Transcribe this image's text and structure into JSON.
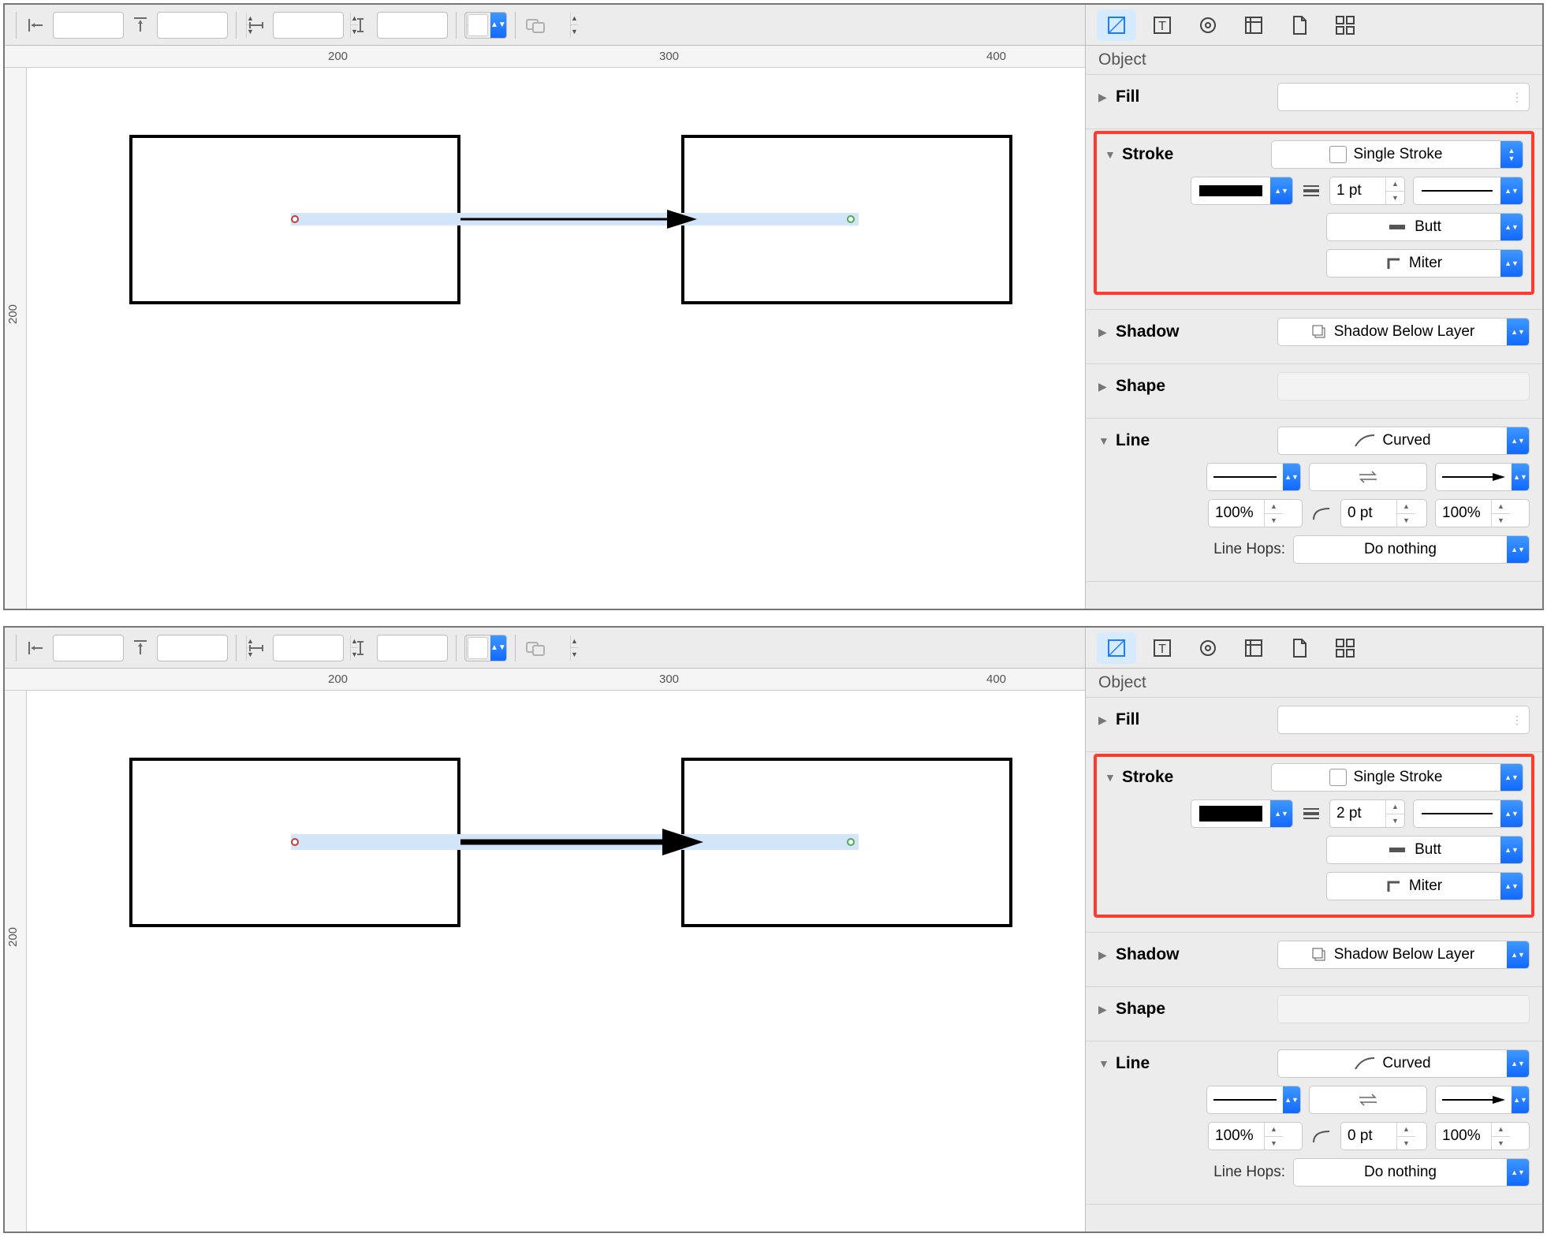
{
  "rulers": {
    "h1": "200",
    "h2": "300",
    "h3": "400",
    "v1": "200"
  },
  "inspector": {
    "title": "Object",
    "fill": {
      "label": "Fill"
    },
    "stroke": {
      "label": "Stroke",
      "type": "Single Stroke",
      "weight_top": "1 pt",
      "weight_bottom": "2 pt",
      "cap": "Butt",
      "join": "Miter"
    },
    "shadow": {
      "label": "Shadow",
      "mode": "Shadow Below Layer"
    },
    "shape": {
      "label": "Shape"
    },
    "line": {
      "label": "Line",
      "type": "Curved",
      "start_scale": "100%",
      "radius": "0 pt",
      "end_scale": "100%",
      "hops_label": "Line Hops:",
      "hops_value": "Do nothing"
    }
  }
}
